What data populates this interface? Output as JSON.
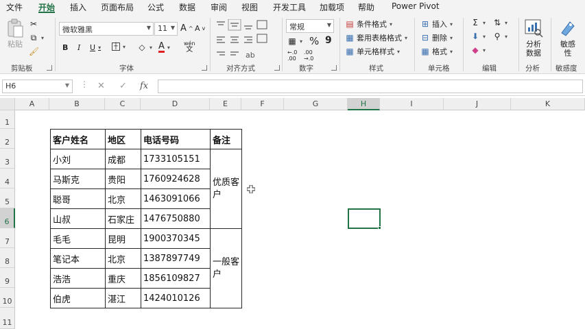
{
  "tabs": [
    "文件",
    "开始",
    "插入",
    "页面布局",
    "公式",
    "数据",
    "审阅",
    "视图",
    "开发工具",
    "加载项",
    "帮助",
    "Power Pivot"
  ],
  "active_tab_index": 1,
  "ribbon": {
    "clipboard": {
      "paste": "粘贴",
      "label": "剪贴板"
    },
    "font": {
      "name": "微软雅黑",
      "size": "11",
      "label": "字体",
      "bold": "B",
      "italic": "I",
      "underline": "U",
      "font_color_letter": "A",
      "phonetic": "wén",
      "grow": "A",
      "shrink": "A"
    },
    "alignment": {
      "label": "对齐方式"
    },
    "number": {
      "format": "常规",
      "label": "数字",
      "percent": "%",
      "comma": "9"
    },
    "styles": {
      "conditional": "条件格式",
      "table": "套用表格格式",
      "cell": "单元格样式",
      "label": "样式"
    },
    "cells": {
      "insert": "插入",
      "delete": "删除",
      "format": "格式",
      "label": "单元格"
    },
    "editing": {
      "label": "编辑"
    },
    "analysis": {
      "button": "分析\n数据",
      "button_line1": "分析",
      "button_line2": "数据",
      "label": "分析"
    },
    "sensitivity": {
      "line1": "敏感",
      "line2": "性",
      "label": "敏感度"
    }
  },
  "formula_bar": {
    "name_box": "H6",
    "cancel": "✕",
    "enter": "✓",
    "fx": "fx",
    "value": ""
  },
  "columns": [
    "A",
    "B",
    "C",
    "D",
    "E",
    "F",
    "G",
    "H",
    "I",
    "J",
    "K"
  ],
  "selected_column": "H",
  "rows": [
    "1",
    "2",
    "3",
    "4",
    "5",
    "6",
    "7",
    "8",
    "9",
    "10",
    "11"
  ],
  "selected_row": "6",
  "table": {
    "headers": [
      "客户姓名",
      "地区",
      "电话号码",
      "备注"
    ],
    "rows": [
      [
        "小刘",
        "成都",
        "1733105151"
      ],
      [
        "马斯克",
        "贵阳",
        "1760924628"
      ],
      [
        "聪哥",
        "北京",
        "1463091066"
      ],
      [
        "山叔",
        "石家庄",
        "1476750880"
      ],
      [
        "毛毛",
        "昆明",
        "1900370345"
      ],
      [
        "笔记本",
        "北京",
        "1387897749"
      ],
      [
        "浩浩",
        "重庆",
        "1856109827"
      ],
      [
        "伯虎",
        "湛江",
        "1424010126"
      ]
    ],
    "notes": [
      "优质客户",
      "一般客户"
    ]
  },
  "colors": {
    "accent": "#217346",
    "ribbon_bg": "#f3f3f3",
    "header_bg": "#efefef"
  }
}
